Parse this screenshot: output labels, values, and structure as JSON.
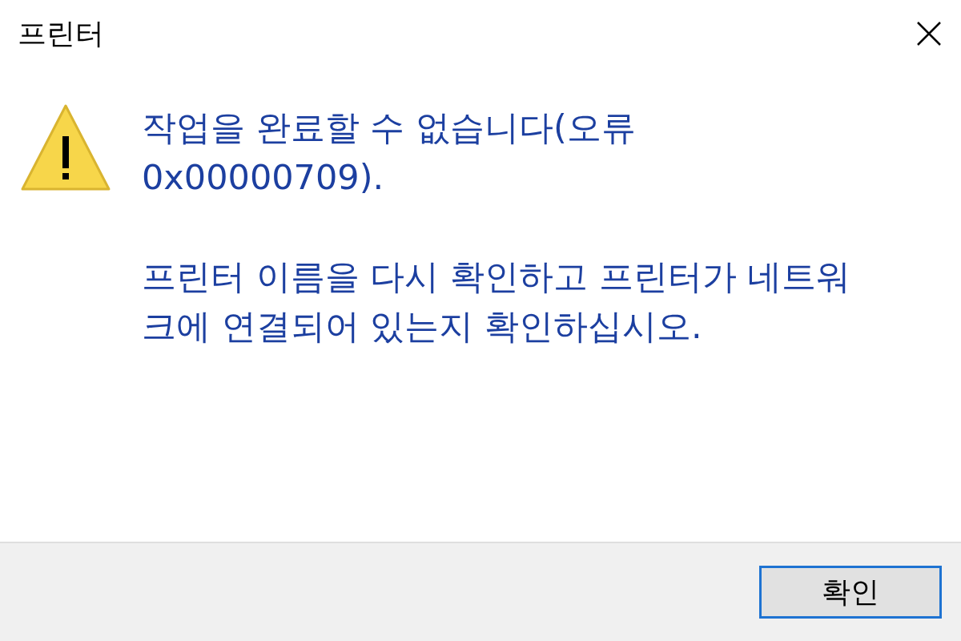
{
  "window": {
    "title": "프린터"
  },
  "message": {
    "heading": "작업을 완료할 수 없습니다(오류 0x00000709).",
    "detail": "프린터 이름을 다시 확인하고 프린터가 네트워크에 연결되어 있는지 확인하십시오."
  },
  "buttons": [
    {
      "label": "확인",
      "selected": true
    }
  ]
}
